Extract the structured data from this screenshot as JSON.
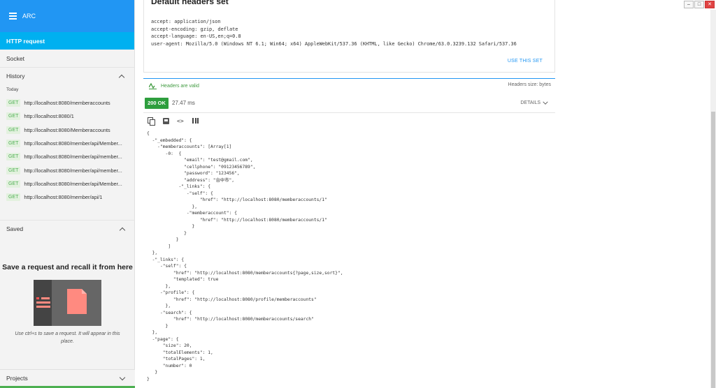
{
  "app": {
    "title": "ARC"
  },
  "sidebar": {
    "http_request": "HTTP request",
    "socket": "Socket",
    "history_label": "History",
    "today_label": "Today",
    "history": [
      {
        "method": "GET",
        "url": "http://localhost:8080/memberaccounts"
      },
      {
        "method": "GET",
        "url": "http://localhost:8080/1"
      },
      {
        "method": "GET",
        "url": "http://localhost:8080/Memberaccounts"
      },
      {
        "method": "GET",
        "url": "http://localhost:8080/member/api/Member..."
      },
      {
        "method": "GET",
        "url": "http://localhost:8080/member/api/member..."
      },
      {
        "method": "GET",
        "url": "http://localhost:8080/member/api/member..."
      },
      {
        "method": "GET",
        "url": "http://localhost:8080/member/api/Member..."
      },
      {
        "method": "GET",
        "url": "http://localhost:8080/member/api/1"
      }
    ],
    "saved_label": "Saved",
    "save_title": "Save a request and recall it from here",
    "save_hint": "Use ctrl+s to save a request. It will appear in this place.",
    "projects_label": "Projects"
  },
  "headers": {
    "title": "Default headers set",
    "lines": [
      "accept: application/json",
      "accept-encoding: gzip, deflate",
      "accept-language: en-US,en;q=0.8",
      "user-agent: Mozilla/5.0 (Windows NT 6.1; Win64; x64) AppleWebKit/537.36 (KHTML, like Gecko) Chrome/63.0.3239.132 Safari/537.36"
    ],
    "use_set": "USE THIS SET",
    "valid_text": "Headers are valid",
    "size_text": "Headers size: bytes"
  },
  "response": {
    "status": "200 OK",
    "time": "27.47 ms",
    "details": "DETAILS",
    "json_lines": [
      "{",
      "  -\"_embedded\": {",
      "    -\"memberaccounts\": [Array[1]",
      "       -0:  {",
      "              \"email\": \"test@gmail.com\",",
      "              \"cellphone\": \"09123456789\",",
      "              \"password\": \"123456\",",
      "              \"address\": \"台中市\",",
      "            -\"_links\": {",
      "               -\"self\": {",
      "                    \"href\": \"http://localhost:8080/memberaccounts/1\"",
      "                 },",
      "               -\"memberaccount\": {",
      "                    \"href\": \"http://localhost:8080/memberaccounts/1\"",
      "                 }",
      "              }",
      "           }",
      "        ]",
      "  },",
      "  -\"_links\": {",
      "     -\"self\": {",
      "          \"href\": \"http://localhost:8080/memberaccounts{?page,size,sort}\",",
      "          \"templated\": true",
      "       },",
      "     -\"profile\": {",
      "          \"href\": \"http://localhost:8080/profile/memberaccounts\"",
      "       },",
      "     -\"search\": {",
      "          \"href\": \"http://localhost:8080/memberaccounts/search\"",
      "       }",
      "  },",
      "  -\"page\": {",
      "      \"size\": 20,",
      "      \"totalElements\": 1,",
      "      \"totalPages\": 1,",
      "      \"number\": 0",
      "   }",
      "}"
    ]
  },
  "window": {
    "min": "–",
    "max": "□",
    "close": "✕"
  },
  "colors": {
    "accent": "#2196f3",
    "nav_active": "#00b0f0",
    "status_ok": "#2e9e3e",
    "method_text": "#4caf50"
  }
}
